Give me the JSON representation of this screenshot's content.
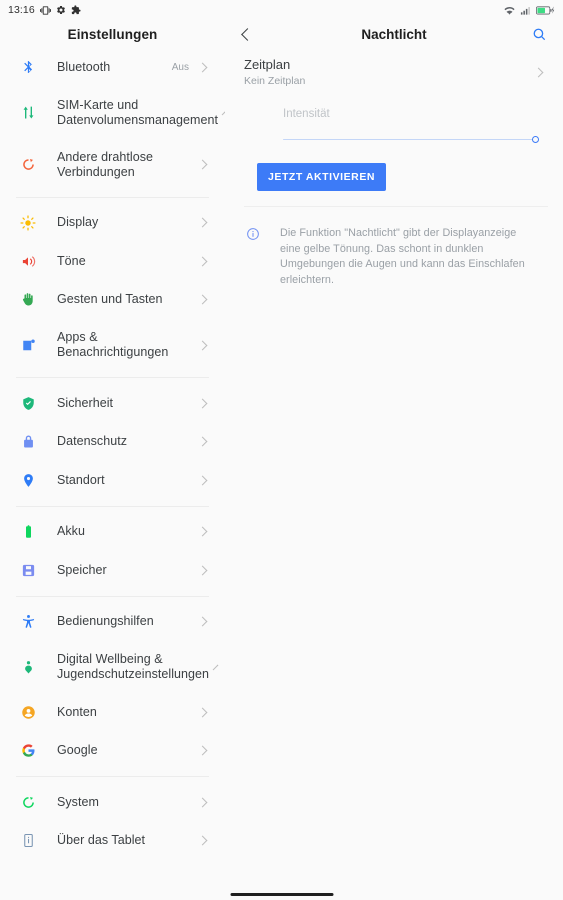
{
  "statusbar": {
    "time": "13:16",
    "left_icons": [
      "vibrate-icon",
      "gear-icon",
      "extension-icon"
    ],
    "right_icons": [
      "wifi-icon",
      "cellular-signal-icon",
      "battery-charging-icon"
    ],
    "battery_color": "#3ddc84"
  },
  "sidebar": {
    "title": "Einstellungen",
    "items": [
      {
        "label": "Bluetooth",
        "value": "Aus",
        "icon": "bluetooth-icon",
        "color": "#2e7cf6",
        "group": 0,
        "tall": false
      },
      {
        "label": "SIM-Karte und Datenvolumensmanagement",
        "value": "",
        "icon": "sim-data-icon",
        "color": "#1db87a",
        "group": 0,
        "tall": true
      },
      {
        "label": "Andere drahtlose Verbindungen",
        "value": "",
        "icon": "wireless-connections-icon",
        "color": "#f4633a",
        "group": 0,
        "tall": true
      },
      {
        "label": "Display",
        "value": "",
        "icon": "brightness-icon",
        "color": "#fbbc04",
        "group": 1,
        "tall": false
      },
      {
        "label": "Töne",
        "value": "",
        "icon": "volume-icon",
        "color": "#ea4335",
        "group": 1,
        "tall": false
      },
      {
        "label": "Gesten und Tasten",
        "value": "",
        "icon": "hand-gesture-icon",
        "color": "#34a853",
        "group": 1,
        "tall": false
      },
      {
        "label": "Apps & Benachrichtigungen",
        "value": "",
        "icon": "apps-notifications-icon",
        "color": "#4285f4",
        "group": 1,
        "tall": true
      },
      {
        "label": "Sicherheit",
        "value": "",
        "icon": "shield-check-icon",
        "color": "#1db87a",
        "group": 2,
        "tall": false
      },
      {
        "label": "Datenschutz",
        "value": "",
        "icon": "lock-icon",
        "color": "#6f8ff2",
        "group": 2,
        "tall": false
      },
      {
        "label": "Standort",
        "value": "",
        "icon": "location-pin-icon",
        "color": "#2e7cf6",
        "group": 2,
        "tall": false
      },
      {
        "label": "Akku",
        "value": "",
        "icon": "battery-icon",
        "color": "#0ed65e",
        "group": 3,
        "tall": false
      },
      {
        "label": "Speicher",
        "value": "",
        "icon": "storage-disk-icon",
        "color": "#7b8cf0",
        "group": 3,
        "tall": false
      },
      {
        "label": "Bedienungshilfen",
        "value": "",
        "icon": "accessibility-icon",
        "color": "#2e7cf6",
        "group": 4,
        "tall": false
      },
      {
        "label": "Digital Wellbeing & Jugendschutzeinstellungen",
        "value": "",
        "icon": "digital-wellbeing-icon",
        "color": "#1db87a",
        "group": 4,
        "tall": true
      },
      {
        "label": "Konten",
        "value": "",
        "icon": "account-circle-icon",
        "color": "#f5a623",
        "group": 4,
        "tall": false
      },
      {
        "label": "Google",
        "value": "",
        "icon": "google-g-icon",
        "color": "#4285f4",
        "group": 4,
        "tall": false
      },
      {
        "label": "System",
        "value": "",
        "icon": "system-update-icon",
        "color": "#0ed65e",
        "group": 5,
        "tall": false
      },
      {
        "label": "Über das Tablet",
        "value": "",
        "icon": "tablet-info-icon",
        "color": "#7a95b3",
        "group": 5,
        "tall": false
      }
    ]
  },
  "detail": {
    "back_label": "back-chevron",
    "title": "Nachtlicht",
    "search_label": "search-icon",
    "schedule": {
      "title": "Zeitplan",
      "subtitle": "Kein Zeitplan"
    },
    "intensity": {
      "label": "Intensität",
      "value": 100,
      "min": 0,
      "max": 100,
      "disabled": true
    },
    "activate_button": "JETZT AKTIVIEREN",
    "accent_color": "#3d7bf7",
    "info": {
      "icon": "info-circle-icon",
      "text": "Die Funktion \"Nachtlicht\" gibt der Displayanzeige eine gelbe Tönung. Das schont in dunklen Umgebungen die Augen und kann das Einschlafen erleichtern."
    }
  },
  "navbar": {
    "pill": "home-gesture-pill"
  }
}
